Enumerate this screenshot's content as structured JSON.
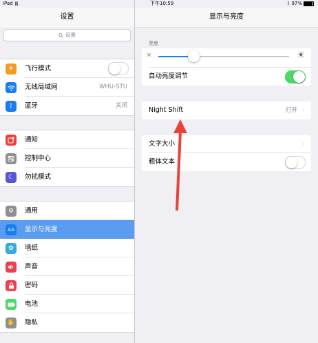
{
  "status_bar": {
    "device": "iPad",
    "time": "下午10:59",
    "battery": "97%"
  },
  "left_panel": {
    "title": "设置",
    "search_placeholder": "设置",
    "groups": [
      [
        {
          "label": "飞行模式",
          "icon": "airplane-icon",
          "color": "#f59a23",
          "control": "toggle-off"
        },
        {
          "label": "无线局域网",
          "icon": "wifi-icon",
          "color": "#1a7cf5",
          "value": "WHU-STU"
        },
        {
          "label": "蓝牙",
          "icon": "bluetooth-icon",
          "color": "#1a7cf5",
          "value": "关闭"
        }
      ],
      [
        {
          "label": "通知",
          "icon": "notifications-icon",
          "color": "#ef3e36"
        },
        {
          "label": "控制中心",
          "icon": "control-center-icon",
          "color": "#8e8e93"
        },
        {
          "label": "勿扰模式",
          "icon": "moon-icon",
          "color": "#5856d6"
        }
      ],
      [
        {
          "label": "通用",
          "icon": "gear-icon",
          "color": "#8e8e93"
        },
        {
          "label": "显示与亮度",
          "icon": "display-brightness-icon",
          "color": "#1a7cf5",
          "selected": true
        },
        {
          "label": "墙纸",
          "icon": "wallpaper-icon",
          "color": "#35aadc"
        },
        {
          "label": "声音",
          "icon": "sound-icon",
          "color": "#ef3e50"
        },
        {
          "label": "密码",
          "icon": "lock-icon",
          "color": "#ef3e50"
        },
        {
          "label": "电池",
          "icon": "battery-icon",
          "color": "#4cd964"
        },
        {
          "label": "隐私",
          "icon": "hand-icon",
          "color": "#8e8e93"
        }
      ]
    ]
  },
  "right_panel": {
    "title": "显示与亮度",
    "brightness_section_label": "亮度",
    "brightness_level": 0.27,
    "auto_brightness_label": "自动亮度调节",
    "auto_brightness_on": true,
    "night_shift_label": "Night Shift",
    "night_shift_value": "打开",
    "text_size_label": "文字大小",
    "bold_text_label": "粗体文本",
    "bold_text_on": false
  },
  "colors": {
    "accent": "#1a7cf5",
    "selected_row": "#5a9cf0",
    "toggle_on": "#4cd964",
    "annotation_arrow": "#e8423a"
  }
}
